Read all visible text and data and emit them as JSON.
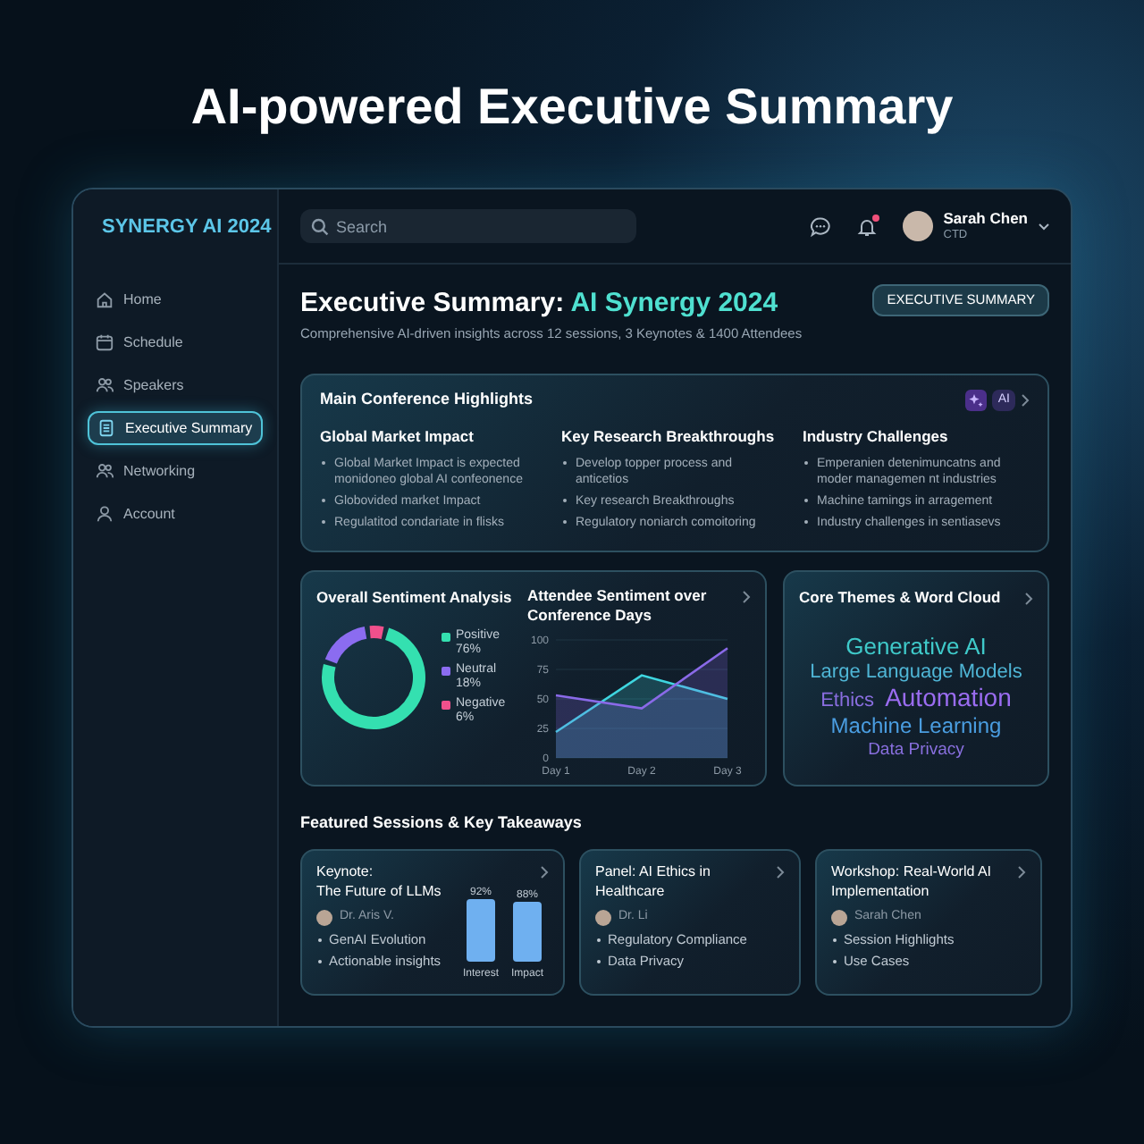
{
  "headline": "AI-powered Executive Summary",
  "app": {
    "logo": "SYNERGY AI 2024"
  },
  "sidebar": {
    "items": [
      {
        "label": "Home",
        "selected": false
      },
      {
        "label": "Schedule",
        "selected": false
      },
      {
        "label": "Speakers",
        "selected": false
      },
      {
        "label": "Executive Summary",
        "selected": true
      },
      {
        "label": "Networking",
        "selected": false
      },
      {
        "label": "Account",
        "selected": false
      }
    ]
  },
  "topbar": {
    "search": {
      "placeholder": "Search"
    },
    "notifications_unread": true,
    "user": {
      "name": "Sarah Chen",
      "role": "CTD"
    }
  },
  "header": {
    "title": "Executive Summary: ",
    "title_highlight": "AI Synergy 2024",
    "subtitle": "Comprehensive AI-driven insights across 12 sessions, 3 Keynotes & 1400 Attendees",
    "button": "EXECUTIVE SUMMARY"
  },
  "highlights": {
    "title": "Main Conference Highlights",
    "ai_badge": "AI",
    "columns": [
      {
        "heading": "Global Market Impact",
        "bullets": [
          "Global Market Impact is expected monidoneo global AI confeonence",
          "Globovided market Impact",
          "Regulatitod condariate in flisks"
        ]
      },
      {
        "heading": "Key Research Breakthroughs",
        "bullets": [
          "Develop topper process and anticetios",
          "Key research Breakthroughs",
          "Regulatory noniarch comoitoring"
        ]
      },
      {
        "heading": "Industry Challenges",
        "bullets": [
          "Emperanien detenimuncatns and moder managemen nt industries",
          "Machine tamings in arragement",
          "Industry challenges in sentiasevs"
        ]
      }
    ]
  },
  "sentiment": {
    "title": "Overall Sentiment Analysis",
    "chart_data": {
      "type": "donut",
      "categories": [
        "Positive",
        "Neutral",
        "Negative"
      ],
      "values": [
        76,
        18,
        6
      ],
      "colors": [
        "#34e0b0",
        "#8b6cf0",
        "#f0508c"
      ],
      "value_labels": [
        "76%",
        "18%",
        "6%"
      ]
    }
  },
  "trend": {
    "title": "Attendee Sentiment over Conference Days",
    "chart_data": {
      "type": "area",
      "categories": [
        "Day 1",
        "Day 2",
        "Day 3"
      ],
      "series": [
        {
          "color": "#3fd6e0",
          "values": [
            22,
            70,
            50
          ]
        },
        {
          "color": "#8a6ae8",
          "values": [
            53,
            42,
            93
          ]
        }
      ],
      "ylim": [
        0,
        100
      ],
      "yticks": [
        0,
        25,
        50,
        75,
        100
      ],
      "grid": true
    }
  },
  "themes": {
    "title": "Core Themes & Word Cloud",
    "words": [
      {
        "text": "Generative AI",
        "color": "#3fc9c9"
      },
      {
        "text": "Large Language Models",
        "color": "#4fb6d6"
      },
      {
        "text": "Ethics",
        "color": "#8a6ee0"
      },
      {
        "text": "Automation",
        "color": "#9a6cf0"
      },
      {
        "text": "Machine Learning",
        "color": "#4a9de0"
      },
      {
        "text": "Data Privacy",
        "color": "#8a70e0"
      }
    ]
  },
  "featured": {
    "title": "Featured Sessions & Key Takeaways",
    "sessions": [
      {
        "title": "Keynote:\nThe Future of LLMs",
        "speaker": "Dr. Aris V.",
        "bullets": [
          "GenAI Evolution",
          "Actionable insights"
        ],
        "chart_data": {
          "type": "bar",
          "categories": [
            "Interest",
            "Impact"
          ],
          "values": [
            92,
            88
          ],
          "ylim": [
            0,
            100
          ],
          "value_labels": [
            "92%",
            "88%"
          ]
        }
      },
      {
        "title": "Panel: AI Ethics in Healthcare",
        "speaker": "Dr. Li",
        "bullets": [
          "Regulatory Compliance",
          "Data Privacy"
        ]
      },
      {
        "title": "Workshop: Real-World AI Implementation",
        "speaker": "Sarah Chen",
        "bullets": [
          "Session Highlights",
          "Use Cases"
        ]
      }
    ]
  }
}
